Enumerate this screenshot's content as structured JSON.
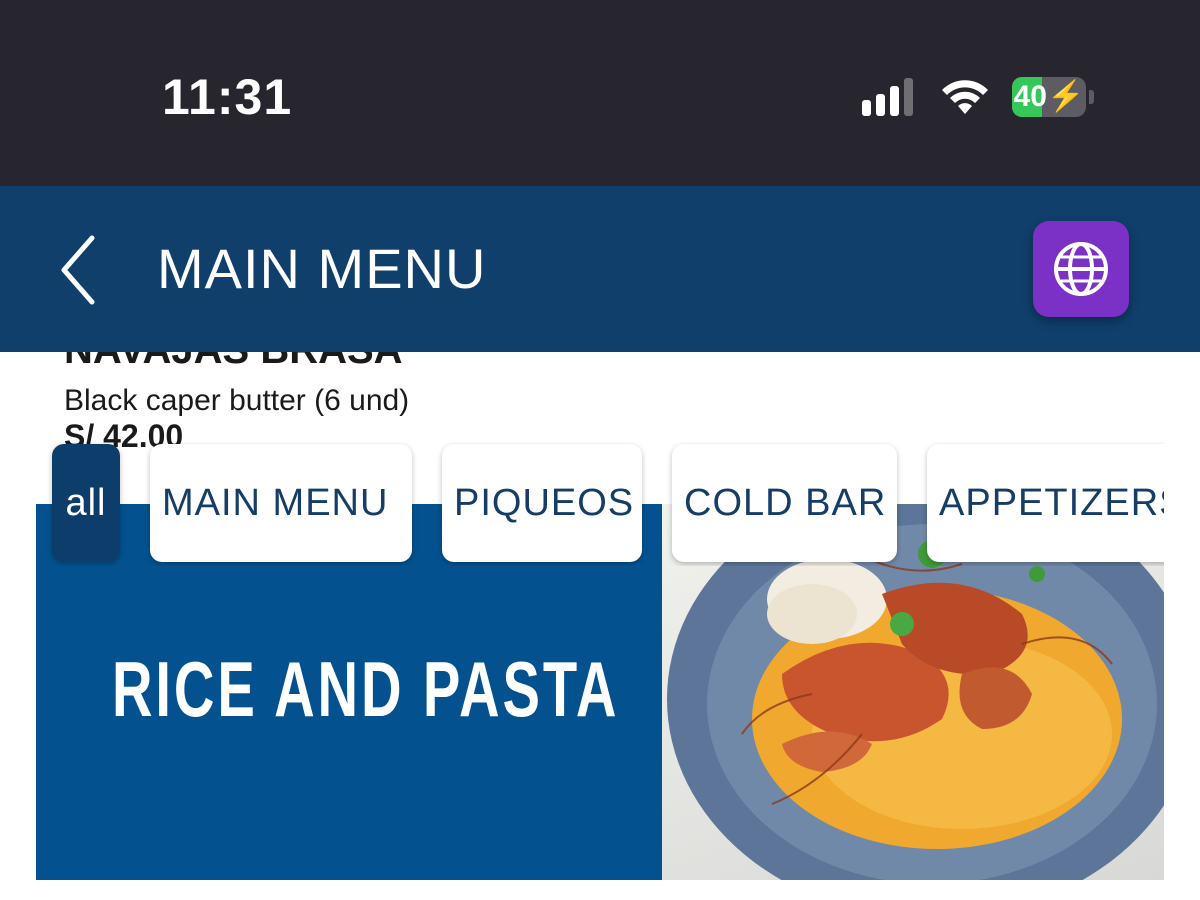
{
  "status_bar": {
    "time": "11:31",
    "battery_level": "40",
    "battery_fraction": 0.4,
    "battery_color": "#35c759",
    "icons": [
      "signal-icon",
      "wifi-icon",
      "battery-icon"
    ]
  },
  "header": {
    "title": "MAIN MENU",
    "back_icon": "chevron-left-icon",
    "language_icon": "globe-icon",
    "background_color": "#103f6c",
    "language_button_color": "#7b30c6"
  },
  "menu_item": {
    "name": "NAVAJAS BRASA",
    "description": "Black caper butter (6 und)",
    "price": "S/ 42.00"
  },
  "categories": [
    {
      "label": "all",
      "active": true
    },
    {
      "label": "MAIN MENU",
      "active": false
    },
    {
      "label": "PIQUEOS",
      "active": false
    },
    {
      "label": "COLD BAR",
      "active": false
    },
    {
      "label": "APPETIZERS",
      "active": false
    }
  ],
  "banner": {
    "title": "RICE AND PASTA",
    "background_color": "#03528f",
    "image": "seafood-risotto-plate"
  }
}
